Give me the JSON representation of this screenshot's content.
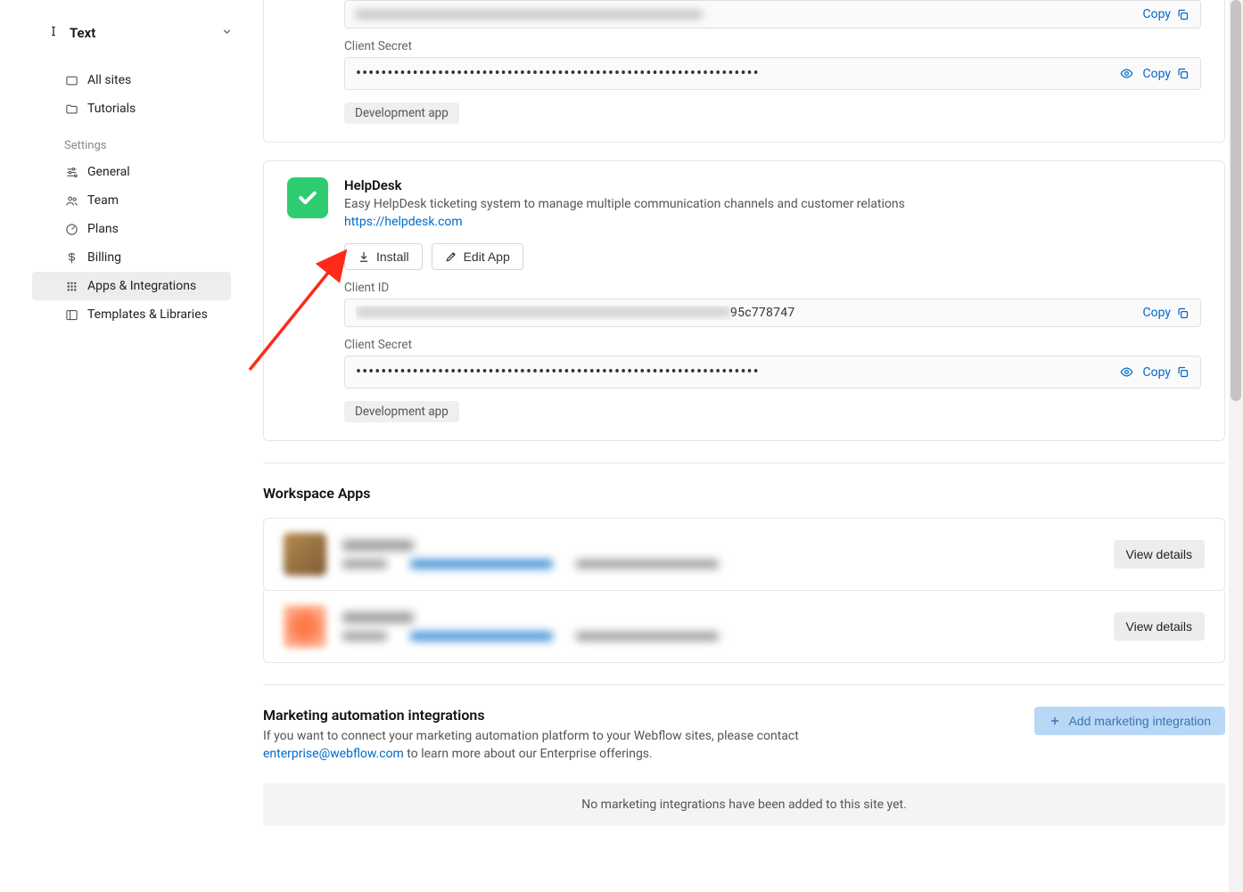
{
  "workspace": {
    "name": "Text"
  },
  "sidebar": {
    "all_sites": "All sites",
    "tutorials": "Tutorials",
    "section_settings": "Settings",
    "general": "General",
    "team": "Team",
    "plans": "Plans",
    "billing": "Billing",
    "apps": "Apps & Integrations",
    "templates": "Templates & Libraries"
  },
  "app1": {
    "client_secret_label": "Client Secret",
    "secret_masked": "••••••••••••••••••••••••••••••••••••••••••••••••••••••••••••••••",
    "copy": "Copy",
    "tag": "Development app"
  },
  "app2": {
    "title": "HelpDesk",
    "desc": "Easy HelpDesk ticketing system to manage multiple communication channels and customer relations",
    "link": "https://helpdesk.com",
    "install": "Install",
    "edit": "Edit App",
    "client_id_label": "Client ID",
    "client_id_tail": "95c778747",
    "client_secret_label": "Client Secret",
    "secret_masked": "••••••••••••••••••••••••••••••••••••••••••••••••••••••••••••••••",
    "copy": "Copy",
    "tag": "Development app"
  },
  "workspace_apps": {
    "title": "Workspace Apps",
    "view_details": "View details"
  },
  "marketing": {
    "title": "Marketing automation integrations",
    "desc_pre": "If you want to connect your marketing automation platform to your Webflow sites, please contact ",
    "email": "enterprise@webflow.com",
    "desc_post": " to learn more about our Enterprise offerings.",
    "add_btn": "Add marketing integration",
    "empty": "No marketing integrations have been added to this site yet."
  }
}
